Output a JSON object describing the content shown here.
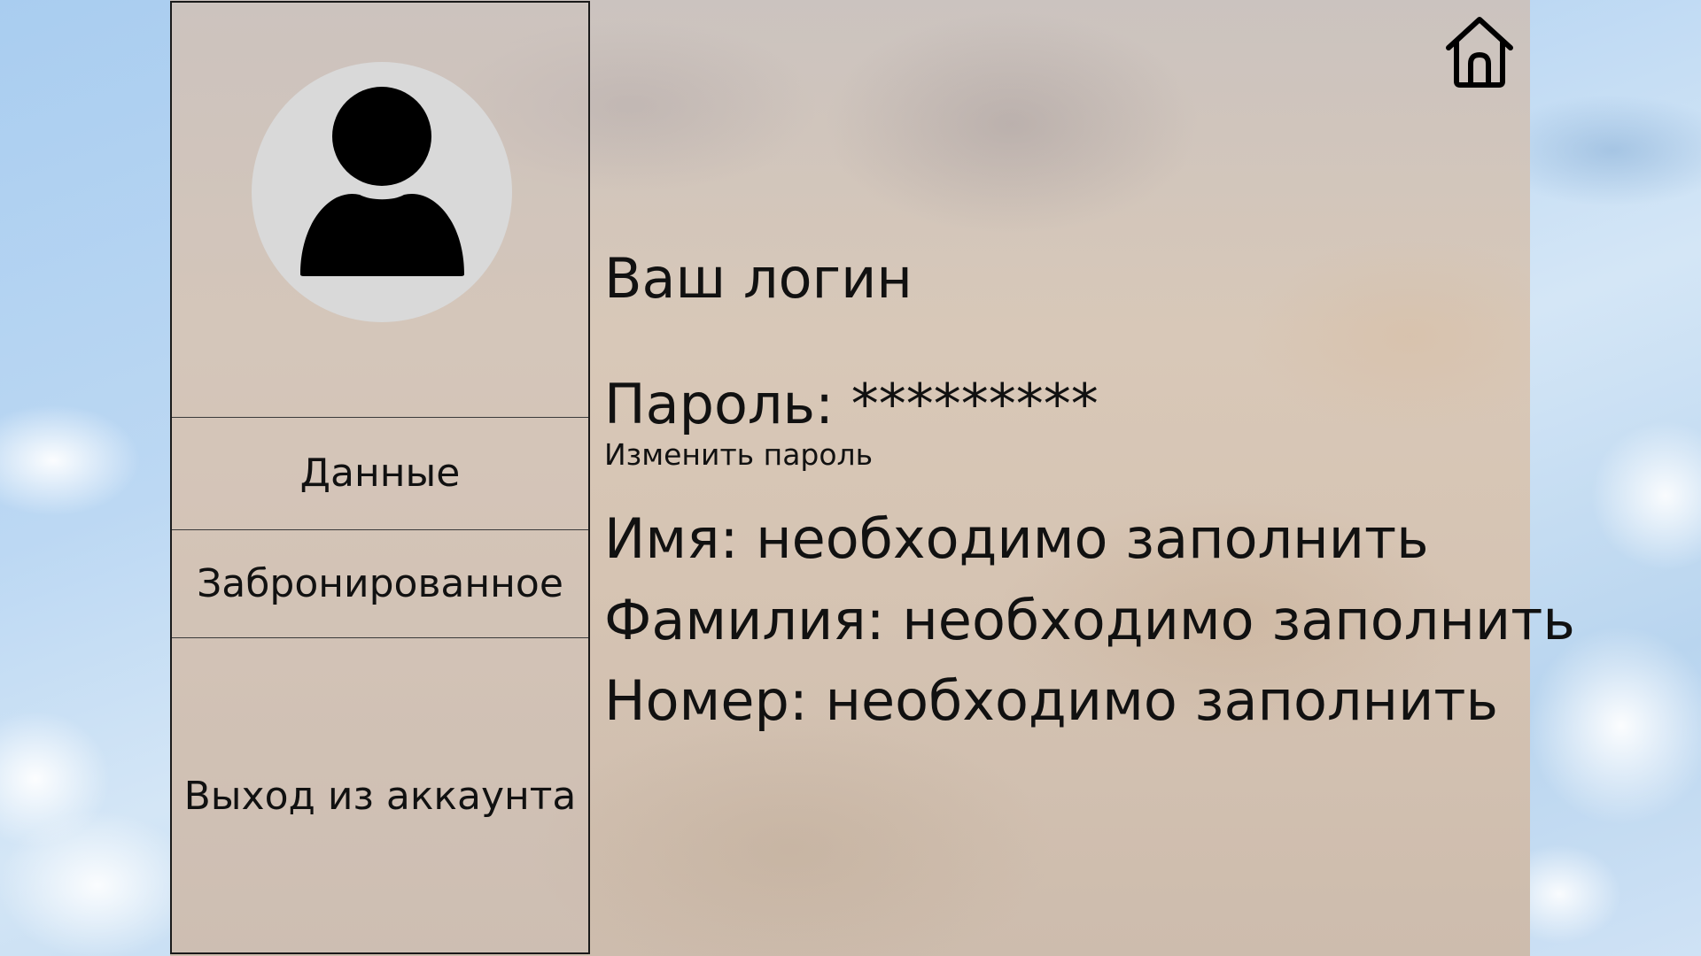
{
  "colors": {
    "sky": "#bcd8f3",
    "panel": "#d8c8b8",
    "avatar_bg": "#d9d9d9",
    "text": "#111111",
    "border": "#1a1a1a"
  },
  "sidebar": {
    "avatar_icon": "user-icon",
    "items": [
      {
        "label": "Данные"
      },
      {
        "label": "Забронированное"
      },
      {
        "label": "Выход из аккаунта"
      }
    ]
  },
  "header": {
    "home_icon": "home-icon"
  },
  "profile": {
    "login": "Ваш логин",
    "password_label": "Пароль:",
    "password_value": "*********",
    "change_password_link": "Изменить пароль",
    "fields": [
      {
        "label": "Имя:",
        "value": "необходимо заполнить"
      },
      {
        "label": "Фамилия:",
        "value": "необходимо заполнить"
      },
      {
        "label": "Номер:",
        "value": "необходимо заполнить"
      }
    ]
  }
}
